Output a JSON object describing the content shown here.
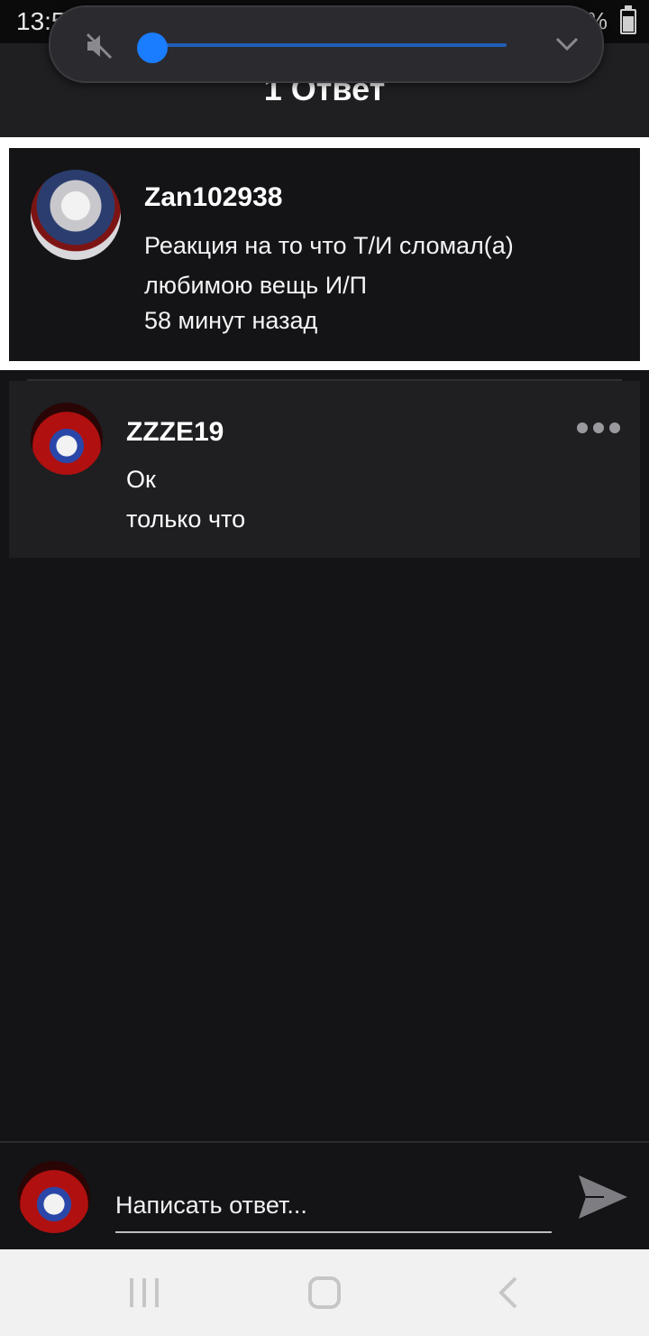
{
  "status_bar": {
    "time": "13:58",
    "notif_icons": "w w",
    "battery": "73%"
  },
  "header": {
    "title": "1 Ответ"
  },
  "volume_panel": {
    "level": 0.0,
    "accent": "#1a7cff"
  },
  "post": {
    "username": "Zan102938",
    "text": "Реакция на то что Т/И сломал(а) любимою вещь И/П",
    "time": "58 минут назад"
  },
  "reply": {
    "username": "ZZZE19",
    "text": "Ок",
    "time": "только что"
  },
  "composer": {
    "placeholder": "Написать ответ..."
  }
}
